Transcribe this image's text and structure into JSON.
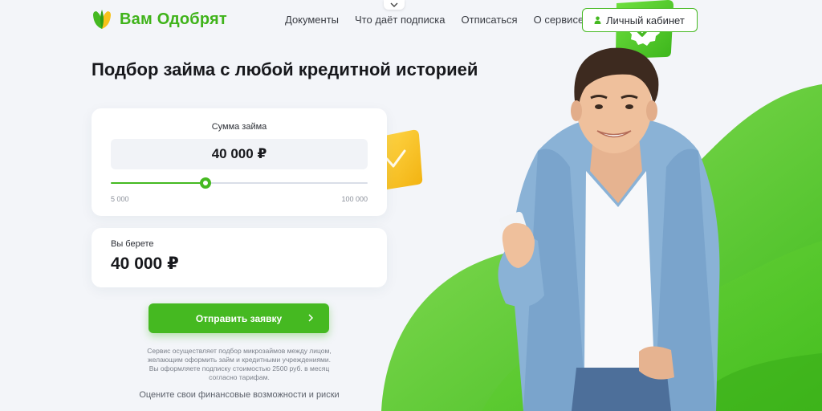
{
  "header": {
    "logo_text": "Вам Одобрят",
    "nav": [
      {
        "label": "Документы"
      },
      {
        "label": "Что даёт подписка"
      },
      {
        "label": "Отписаться"
      },
      {
        "label": "О сервисе"
      }
    ],
    "cabinet_label": "Личный кабинет"
  },
  "hero": {
    "title": "Подбор займа с любой кредитной историей"
  },
  "calculator": {
    "amount_label": "Сумма займа",
    "amount_value": "40 000 ₽",
    "slider": {
      "min": 5000,
      "max": 100000,
      "value": 40000
    },
    "min_label": "5 000",
    "max_label": "100 000"
  },
  "result": {
    "label": "Вы берете",
    "value": "40 000 ₽"
  },
  "submit_label": "Отправить заявку",
  "disclaimer": "Сервис осуществляет подбор микрозаймов между лицом, желающим оформить займ и кредитными учреждениями. Вы оформляете подписку стоимостью 2500 руб. в месяц согласно тарифам.",
  "assess_link": "Оцените свои финансовые возможности и риски",
  "colors": {
    "accent": "#45b921",
    "logo": "#3fb31a",
    "background": "#f3f5f9",
    "deco_yellow": "#f6c21a"
  },
  "icons": {
    "top_tab": "chevron-down-icon",
    "logo": "leaf-logo-icon",
    "cabinet": "user-icon",
    "submit": "chevron-right-icon",
    "badge": "check-badge-icon"
  }
}
